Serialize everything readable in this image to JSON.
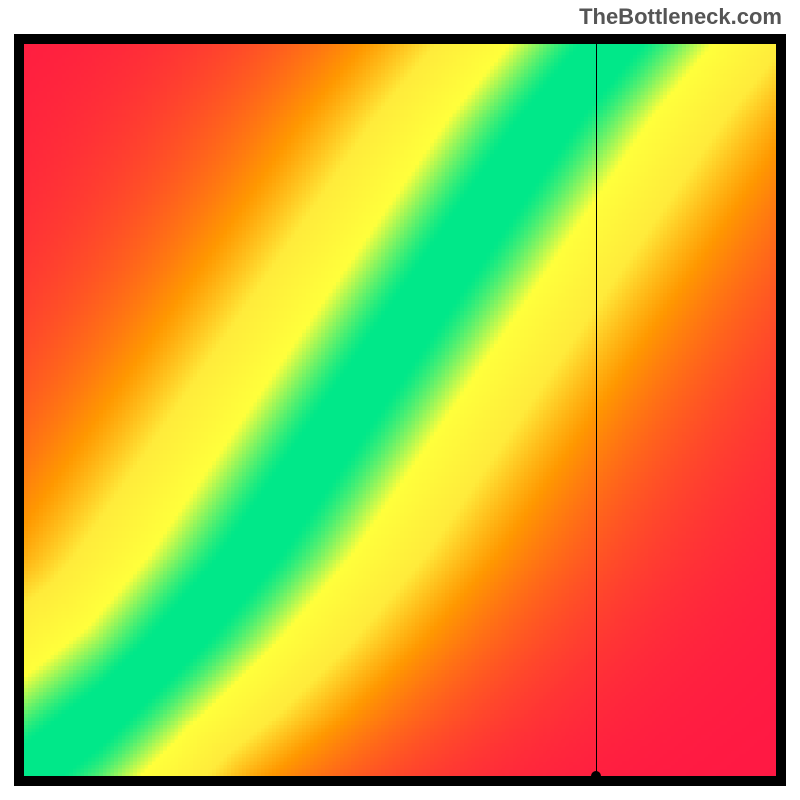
{
  "watermark": "TheBottleneck.com",
  "chart_data": {
    "type": "heatmap",
    "title": "",
    "xlabel": "",
    "ylabel": "",
    "xlim": [
      0,
      100
    ],
    "ylim": [
      0,
      100
    ],
    "marker": {
      "x": 76,
      "y": 0
    },
    "crosshair": {
      "x": 76,
      "y": 0
    },
    "colorscale": [
      {
        "stop": 0.0,
        "color": "#ff1744"
      },
      {
        "stop": 0.35,
        "color": "#ff9800"
      },
      {
        "stop": 0.55,
        "color": "#ffeb3b"
      },
      {
        "stop": 0.8,
        "color": "#ffff3b"
      },
      {
        "stop": 1.0,
        "color": "#00e889"
      }
    ],
    "ridge": {
      "description": "Optimal (green) band follows a monotonically increasing curve from bottom-left to top-right, steeper than y=x in the upper half, with slight S-bend near origin",
      "control_points": [
        {
          "x": 0,
          "y": 0
        },
        {
          "x": 10,
          "y": 8
        },
        {
          "x": 20,
          "y": 18
        },
        {
          "x": 30,
          "y": 30
        },
        {
          "x": 40,
          "y": 45
        },
        {
          "x": 50,
          "y": 60
        },
        {
          "x": 60,
          "y": 75
        },
        {
          "x": 70,
          "y": 90
        },
        {
          "x": 78,
          "y": 100
        }
      ],
      "band_halfwidth": 4
    }
  }
}
